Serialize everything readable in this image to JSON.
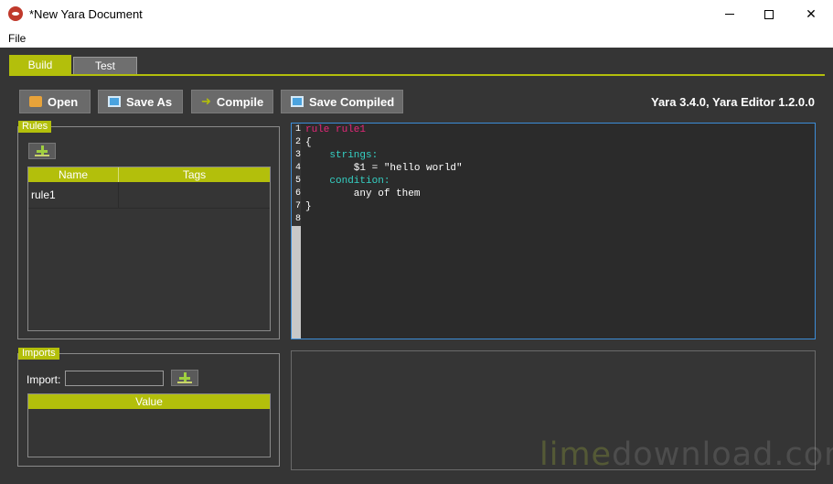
{
  "window": {
    "title": "*New Yara Document"
  },
  "menu": {
    "file": "File"
  },
  "tabs": [
    {
      "label": "Build",
      "active": true
    },
    {
      "label": "Test",
      "active": false
    }
  ],
  "toolbar": {
    "open": "Open",
    "save_as": "Save As",
    "compile": "Compile",
    "save_compiled": "Save Compiled",
    "version": "Yara 3.4.0, Yara Editor 1.2.0.0"
  },
  "rules": {
    "title": "Rules",
    "columns": [
      "Name",
      "Tags"
    ],
    "rows": [
      {
        "name": "rule1",
        "tags": ""
      }
    ]
  },
  "imports": {
    "title": "Imports",
    "import_label": "Import:",
    "import_value": "",
    "columns": [
      "Value"
    ]
  },
  "editor": {
    "line_numbers": [
      "1",
      "2",
      "3",
      "4",
      "5",
      "6",
      "7",
      "8"
    ],
    "lines": {
      "l1": "rule rule1",
      "l2": "{",
      "l3": "    strings:",
      "l4": "        $1 = \"hello world\"",
      "l5": "    condition:",
      "l6": "        any of them",
      "l7": "}",
      "l8": ""
    }
  },
  "watermark": {
    "part1": "lime",
    "part2": "download.com"
  },
  "colors": {
    "accent": "#b3bf0b",
    "background": "#353535",
    "keyword_rule": "#e8277a",
    "keyword_section": "#35d1c4",
    "editor_border": "#3c8dd8"
  },
  "icons": {
    "app": "yara-eye-icon",
    "open": "folder-icon",
    "save": "floppy-disk-icon",
    "compile": "arrow-icon",
    "add": "plus-icon"
  }
}
